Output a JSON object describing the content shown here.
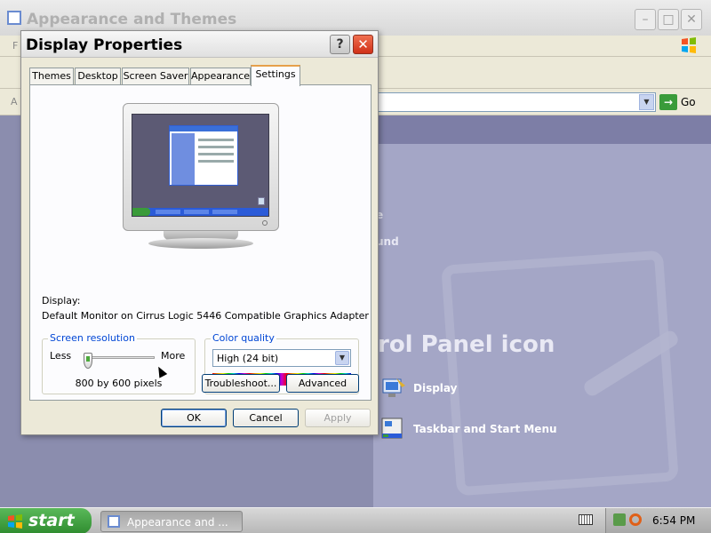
{
  "background_window": {
    "title": "Appearance and Themes",
    "menu_letter": "F",
    "address_letter": "A",
    "go_label": "Go",
    "fragment_1": "e",
    "fragment_2": "und",
    "panel_heading": "rol Panel icon",
    "links": [
      {
        "label": "Display",
        "icon": "display-icon"
      },
      {
        "label": "Taskbar and Start Menu",
        "icon": "taskbar-icon"
      }
    ]
  },
  "dialog": {
    "title": "Display Properties",
    "help_label": "?",
    "close_label": "✕",
    "tabs": [
      {
        "label": "Themes"
      },
      {
        "label": "Desktop"
      },
      {
        "label": "Screen Saver"
      },
      {
        "label": "Appearance"
      },
      {
        "label": "Settings",
        "active": true
      }
    ],
    "display_label": "Display:",
    "display_value": "Default Monitor on Cirrus Logic 5446 Compatible Graphics Adapter",
    "screen_resolution": {
      "title": "Screen resolution",
      "less": "Less",
      "more": "More",
      "value": "800 by 600 pixels",
      "slider_level": 0.0
    },
    "color_quality": {
      "title": "Color quality",
      "selected": "High (24 bit)"
    },
    "buttons": {
      "troubleshoot": "Troubleshoot...",
      "advanced": "Advanced",
      "ok": "OK",
      "cancel": "Cancel",
      "apply": "Apply"
    }
  },
  "taskbar": {
    "start_label": "start",
    "task_label": "Appearance and ...",
    "clock": "6:54 PM"
  },
  "colors": {
    "xp_blue": "#0046d5",
    "start_green": "#3a9b3a",
    "close_red": "#d03018"
  }
}
